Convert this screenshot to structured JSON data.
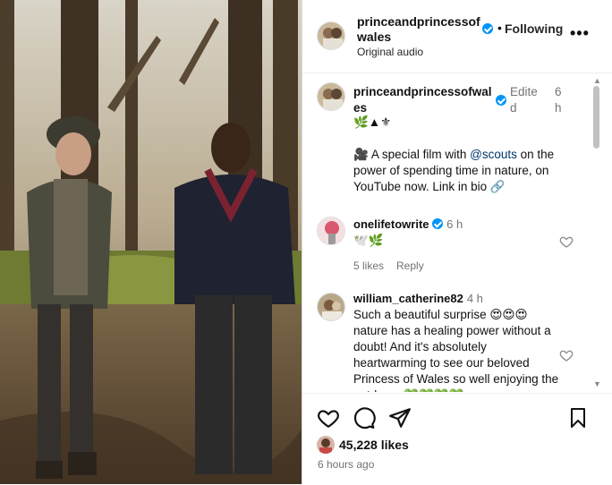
{
  "post": {
    "username_line1": "princeandprincessof",
    "username_line2": "wales",
    "following_label": "Following",
    "dot": "•",
    "audio": "Original audio",
    "more_label": "•••"
  },
  "caption": {
    "username": "princeandprincessofwales",
    "edited": "Edited",
    "time": "6 h",
    "emoji_line": "🌿▲⚜",
    "text_prefix": "🎥 A special film with ",
    "mention": "@scouts",
    "text_suffix": " on the power of spending time in nature, on YouTube now. Link in bio 🔗"
  },
  "comments": [
    {
      "username": "onelifetowrite",
      "time": "6 h",
      "text": "🕊️🌿",
      "likes": "5 likes",
      "reply": "Reply"
    },
    {
      "username": "william_catherine82",
      "time": "4 h",
      "text": "Such a beautiful surprise 😍😍😍 nature has a healing power without a doubt! And it's absolutely heartwarming to see our beloved Princess of Wales so well enjoying the outdoors 💚💚💚💚"
    }
  ],
  "footer": {
    "likes": "45,228 likes",
    "time_ago": "6 hours ago"
  },
  "scrollbar": {
    "up": "▲",
    "down": "▼"
  },
  "colors": {
    "verified": "#0095f6",
    "link": "#00376b",
    "muted": "#737373"
  }
}
